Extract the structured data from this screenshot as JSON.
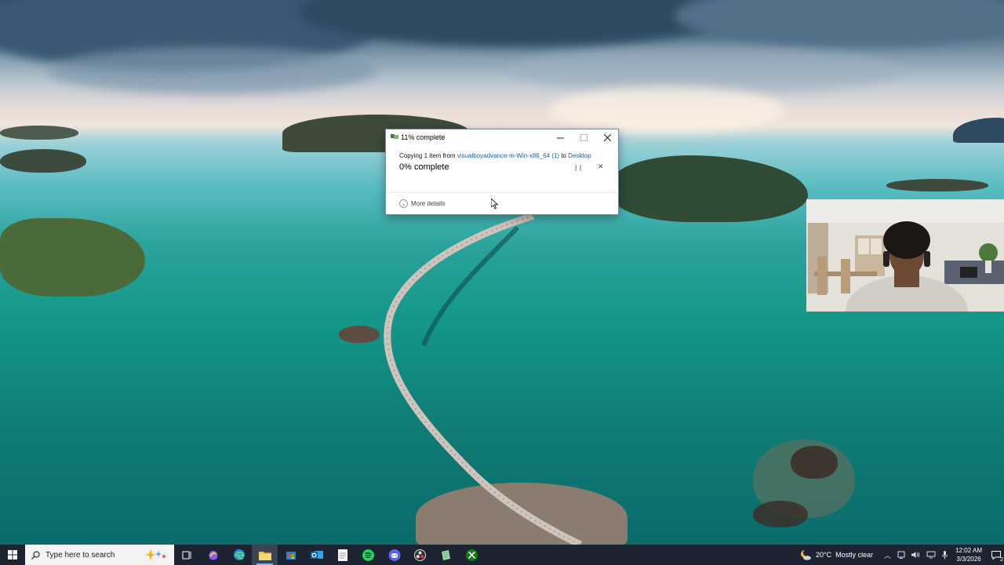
{
  "dialog": {
    "title": "11% complete",
    "copy_prefix": "Copying 1 item from ",
    "source": "visualboyadvance-m-Win-x86_64 (1)",
    "copy_mid": " to ",
    "destination": "Desktop",
    "complete_text": "0% complete",
    "more_details": "More details",
    "progress_fraction": 0.11
  },
  "taskbar": {
    "search_placeholder": "Type here to search",
    "pinned_apps": [
      "task-view",
      "copilot",
      "edge",
      "file-explorer",
      "microsoft-store",
      "outlook",
      "notepad",
      "spotify",
      "discord",
      "obs",
      "notepad-plus",
      "xbox"
    ],
    "active_app": "file-explorer"
  },
  "tray": {
    "temperature": "20°C",
    "weather": "Mostly clear",
    "time": "12:02 AM",
    "date": "3/3/2026",
    "notification_count": "2"
  },
  "colors": {
    "taskbar_bg": "#1b2430",
    "link": "#1a5fb4",
    "accent": "#7db3e6"
  }
}
